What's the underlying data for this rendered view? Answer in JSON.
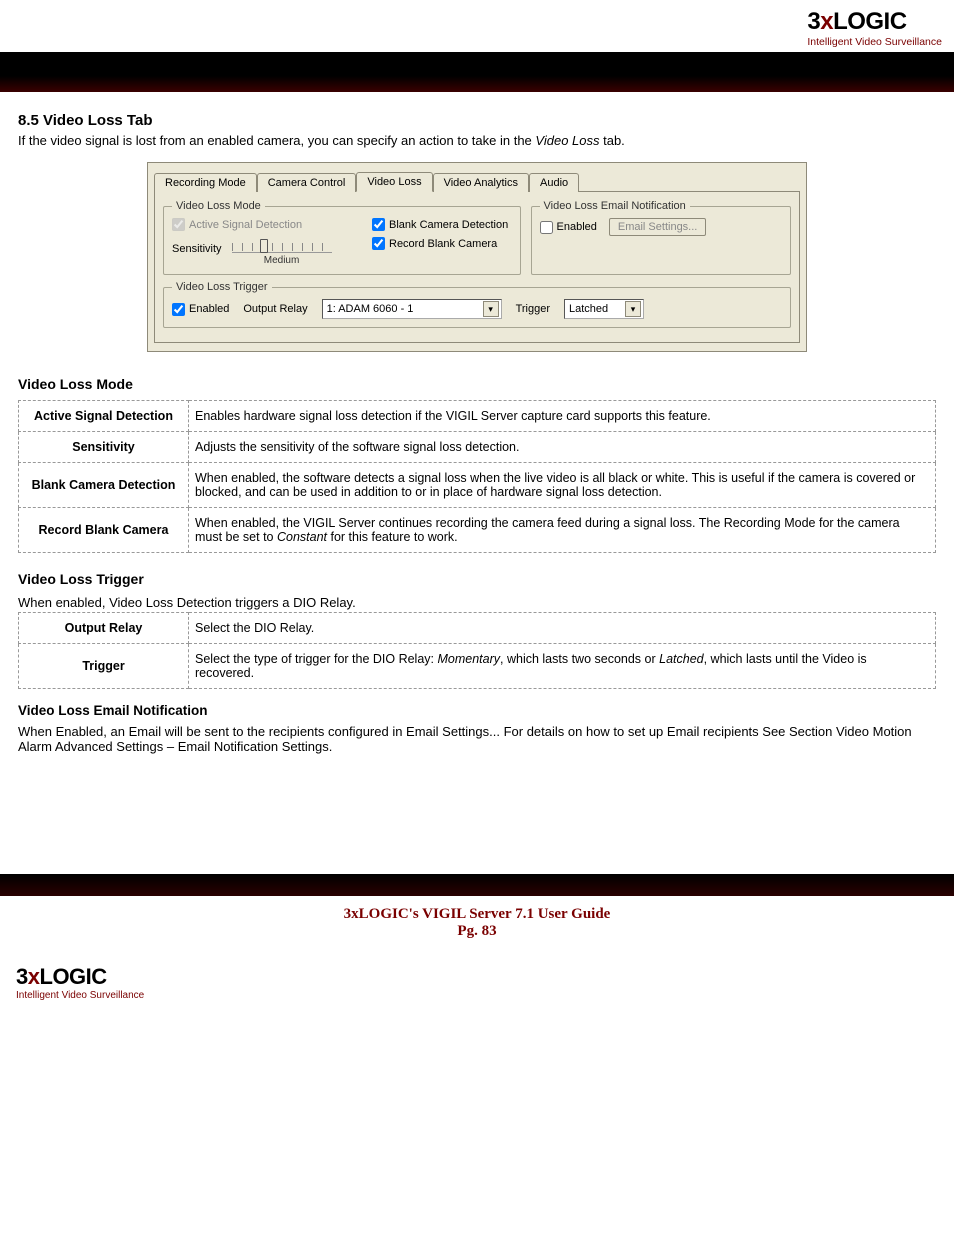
{
  "brand": {
    "logo_line1": "3",
    "logo_x": "x",
    "logo_line2": "LOGIC",
    "logo_sub": "Intelligent Video Surveillance"
  },
  "section": {
    "heading": "8.5 Video Loss Tab",
    "intro_prefix": "If the video signal is lost from an enabled camera, you can specify an action to take in the ",
    "intro_italic": "Video Loss",
    "intro_suffix": " tab."
  },
  "dialog": {
    "tabs": [
      "Recording Mode",
      "Camera Control",
      "Video Loss",
      "Video Analytics",
      "Audio"
    ],
    "selected_tab": 2,
    "mode_group": "Video Loss Mode",
    "active_sig": "Active Signal Detection",
    "blank_cam": "Blank Camera Detection",
    "sensitivity": "Sensitivity",
    "sens_value": "Medium",
    "record_blank": "Record Blank Camera",
    "email_group": "Video Loss Email Notification",
    "enabled": "Enabled",
    "email_btn": "Email Settings...",
    "trigger_group": "Video Loss Trigger",
    "output_relay": "Output Relay",
    "relay_value": "1: ADAM 6060 - 1",
    "trigger_label": "Trigger",
    "trigger_value": "Latched"
  },
  "mode_table_heading": "Video Loss Mode",
  "mode_table": [
    {
      "label": "Active Signal Detection",
      "desc": "Enables hardware signal loss detection if the VIGIL Server capture card supports this feature."
    },
    {
      "label": "Sensitivity",
      "desc": "Adjusts the sensitivity of the software signal loss detection."
    },
    {
      "label": "Blank Camera Detection",
      "desc": "When enabled, the software detects a signal loss when the live video is all black or white. This is useful if the camera is covered or blocked, and can be used in addition to or in place of hardware signal loss detection."
    },
    {
      "label": "Record Blank Camera",
      "desc_pre": "When enabled, the VIGIL Server continues recording the camera feed during a signal loss.  The Recording Mode for the camera must be set to ",
      "desc_it": "Constant",
      "desc_post": " for this feature to work."
    }
  ],
  "trigger_heading": "Video Loss Trigger",
  "trigger_intro": "When enabled, Video Loss Detection triggers a DIO Relay.",
  "trigger_table": [
    {
      "label": "Output Relay",
      "desc": "Select the DIO Relay."
    },
    {
      "label": "Trigger",
      "desc_pre": "Select the type of trigger for the DIO Relay: ",
      "it1": "Momentary",
      "mid": ", which lasts two seconds or ",
      "it2": "Latched",
      "desc_post": ", which lasts until the Video is recovered."
    }
  ],
  "email_heading": "Video Loss Email Notification",
  "email_para": "When Enabled, an Email will be sent to the recipients configured in Email Settings...  For details on how to set up Email recipients See Section Video Motion Alarm Advanced Settings – Email Notification Settings.",
  "footer": {
    "line1": "3xLOGIC's VIGIL Server 7.1 User Guide",
    "line2": "Pg. 83"
  }
}
